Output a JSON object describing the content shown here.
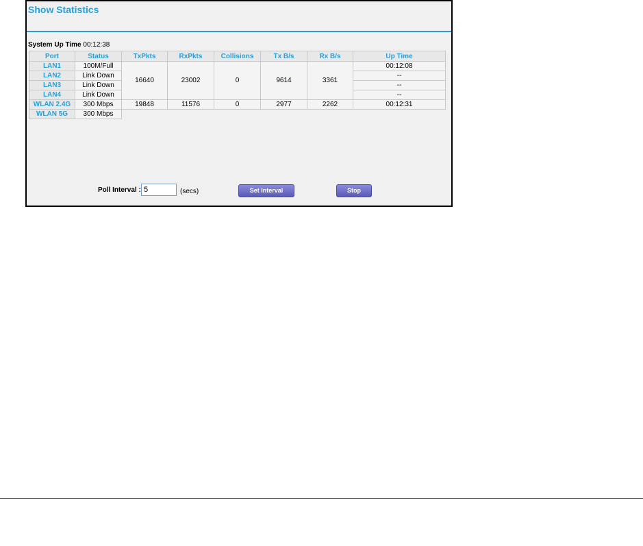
{
  "page": {
    "title": "Show Statistics",
    "system_up_time_label": "System Up Time",
    "system_up_time_value": "00:12:38"
  },
  "table": {
    "headers": [
      "Port",
      "Status",
      "TxPkts",
      "RxPkts",
      "Collisions",
      "Tx B/s",
      "Rx B/s",
      "Up Time"
    ],
    "lan_group": {
      "txpkts": "16640",
      "rxpkts": "23002",
      "collisions": "0",
      "tx_bs": "9614",
      "rx_bs": "3361"
    },
    "rows": [
      {
        "port": "LAN1",
        "status": "100M/Full",
        "uptime": "00:12:08"
      },
      {
        "port": "LAN2",
        "status": "Link Down",
        "uptime": "--"
      },
      {
        "port": "LAN3",
        "status": "Link Down",
        "uptime": "--"
      },
      {
        "port": "LAN4",
        "status": "Link Down",
        "uptime": "--"
      },
      {
        "port": "WLAN 2.4G",
        "status": "300 Mbps",
        "txpkts": "19848",
        "rxpkts": "11576",
        "collisions": "0",
        "tx_bs": "2977",
        "rx_bs": "2262",
        "uptime": "00:12:31"
      },
      {
        "port": "WLAN 5G",
        "status": "300 Mbps"
      }
    ]
  },
  "poll": {
    "label": "Poll Interval :",
    "value": "5",
    "unit": "(secs)",
    "set_button": "Set Interval",
    "stop_button": "Stop"
  },
  "colors": {
    "accent": "#2a9fd6",
    "button": "#6a6ac8"
  }
}
